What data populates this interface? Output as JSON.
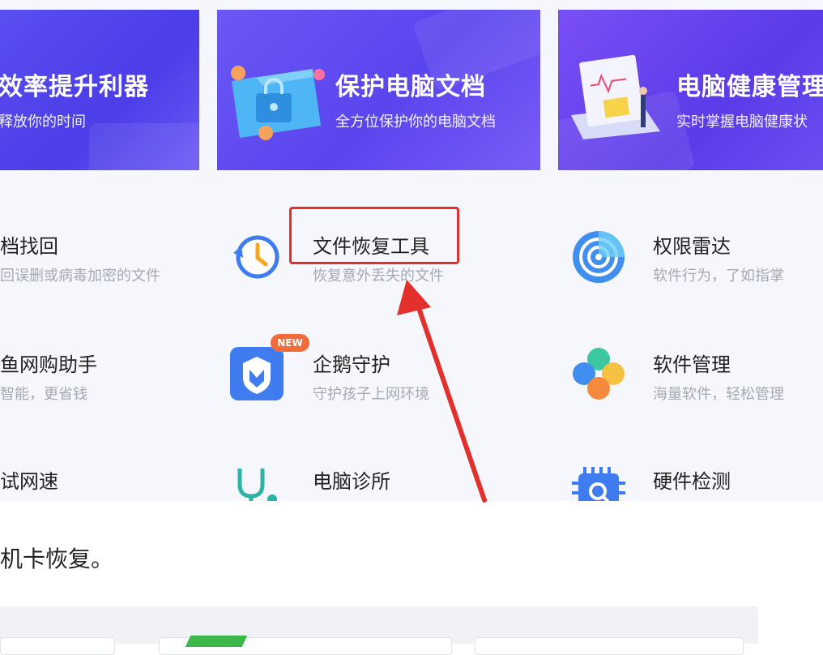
{
  "banners": [
    {
      "title": "效率提升利器",
      "subtitle": "释放你的时间"
    },
    {
      "title": "保护电脑文档",
      "subtitle": "全方位保护你的电脑文档"
    },
    {
      "title": "电脑健康管理",
      "subtitle": "实时掌握电脑健康状"
    }
  ],
  "tools": {
    "left_partial": [
      {
        "name": "档找回",
        "desc": "回误删或病毒加密的文件"
      },
      {
        "name": "鱼网购助手",
        "desc": "智能，更省钱"
      },
      {
        "name": "试网速",
        "desc": ""
      }
    ],
    "middle": [
      {
        "name": "文件恢复工具",
        "desc": "恢复意外丢失的文件",
        "icon": "clock-restore-icon"
      },
      {
        "name": "企鹅守护",
        "desc": "守护孩子上网环境",
        "icon": "penguin-shield-icon",
        "badge": "NEW"
      },
      {
        "name": "电脑诊所",
        "desc": "",
        "icon": "stethoscope-icon"
      }
    ],
    "right": [
      {
        "name": "权限雷达",
        "desc": "软件行为，了如指掌",
        "icon": "radar-icon"
      },
      {
        "name": "软件管理",
        "desc": "海量软件，轻松管理",
        "icon": "clover-icon"
      },
      {
        "name": "硬件检测",
        "desc": "",
        "icon": "chip-search-icon"
      }
    ]
  },
  "caption": "机卡恢复。",
  "colors": {
    "highlight": "#e4302b",
    "arrow": "#e4302b",
    "accent_blue": "#3f7cf0",
    "badge": "#f26b3a"
  }
}
